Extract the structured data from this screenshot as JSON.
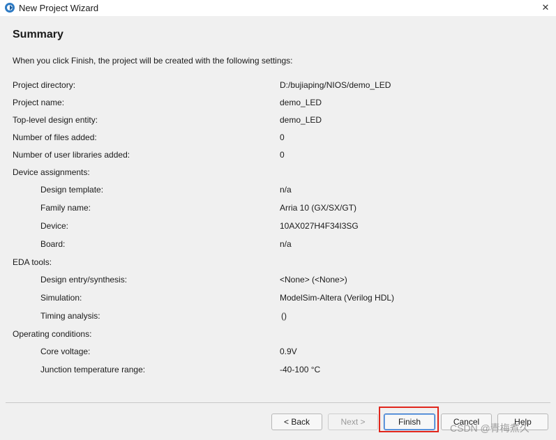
{
  "window": {
    "title": "New Project Wizard",
    "close_glyph": "✕"
  },
  "page": {
    "title": "Summary",
    "intro": "When you click Finish, the project will be created with the following settings:"
  },
  "settings": {
    "project_directory": {
      "label": "Project directory:",
      "value": "D:/bujiaping/NIOS/demo_LED"
    },
    "project_name": {
      "label": "Project name:",
      "value": "demo_LED"
    },
    "top_level": {
      "label": "Top-level design entity:",
      "value": "demo_LED"
    },
    "files_added": {
      "label": "Number of files added:",
      "value": "0"
    },
    "user_libraries": {
      "label": "Number of user libraries added:",
      "value": "0"
    },
    "device_assignments": {
      "label": "Device assignments:"
    },
    "design_template": {
      "label": "Design template:",
      "value": "n/a"
    },
    "family_name": {
      "label": "Family name:",
      "value": "Arria 10 (GX/SX/GT)"
    },
    "device": {
      "label": "Device:",
      "value": "10AX027H4F34I3SG"
    },
    "board": {
      "label": "Board:",
      "value": "n/a"
    },
    "eda_tools": {
      "label": "EDA tools:"
    },
    "design_entry": {
      "label": "Design entry/synthesis:",
      "value": "<None> (<None>)"
    },
    "simulation": {
      "label": "Simulation:",
      "value": "ModelSim-Altera (Verilog HDL)"
    },
    "timing_analysis": {
      "label": "Timing analysis:",
      "value": "()"
    },
    "operating_conditions": {
      "label": "Operating conditions:"
    },
    "core_voltage": {
      "label": "Core voltage:",
      "value": "0.9V"
    },
    "junction_temp": {
      "label": "Junction temperature range:",
      "value": "-40-100 °C"
    }
  },
  "buttons": {
    "back": "< Back",
    "next": "Next >",
    "finish": "Finish",
    "cancel": "Cancel",
    "help": "Help"
  },
  "watermark": "CSDN @青梅煮久",
  "colors": {
    "highlight": "#e0261c",
    "background": "#f0f0f0"
  }
}
